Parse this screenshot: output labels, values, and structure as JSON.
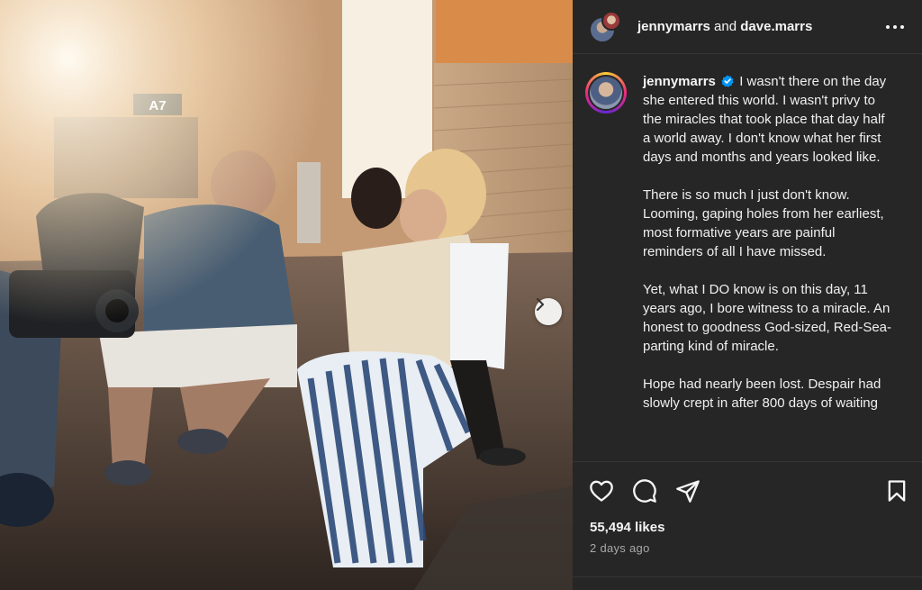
{
  "post": {
    "header": {
      "user1": "jennymarrs",
      "joiner": "and",
      "user2": "dave.marrs"
    },
    "photo": {
      "gate_sign": "A7"
    },
    "caption": {
      "username": "jennymarrs",
      "paragraphs": [
        "I wasn't there on the day she entered this world. I wasn't privy to the miracles that took place that day half a world away. I don't know what her first days and months and years looked like.",
        "There is so much I just don't know. Looming, gaping holes from her earliest, most formative years are painful reminders of all I have missed.",
        "Yet, what I DO know is on this day, 11 years ago, I bore witness to a miracle. An honest to goodness God-sized, Red-Sea-parting kind of miracle.",
        "Hope had nearly been lost. Despair had slowly crept in after 800 days of waiting"
      ]
    },
    "likes": "55,494 likes",
    "time": "2 days ago"
  },
  "icons": {
    "like": "heart-icon",
    "comment": "comment-icon",
    "share": "send-icon",
    "save": "bookmark-icon",
    "more": "more-icon",
    "next": "chevron-right-icon",
    "verified": "verified-badge-icon"
  },
  "colors": {
    "panel": "#262626",
    "text": "#f5f5f5",
    "muted": "#a8a8a8",
    "verified": "#0095f6"
  }
}
